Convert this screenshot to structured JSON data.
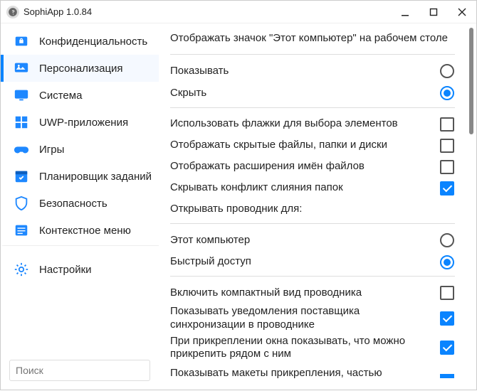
{
  "app": {
    "title": "SophiApp 1.0.84"
  },
  "search": {
    "placeholder": "Поиск"
  },
  "sidebar": {
    "items": [
      {
        "label": "Конфиденциальность",
        "icon": "privacy",
        "active": false
      },
      {
        "label": "Персонализация",
        "icon": "personalize",
        "active": true
      },
      {
        "label": "Система",
        "icon": "system",
        "active": false
      },
      {
        "label": "UWP-приложения",
        "icon": "uwp",
        "active": false
      },
      {
        "label": "Игры",
        "icon": "games",
        "active": false
      },
      {
        "label": "Планировщик заданий",
        "icon": "scheduler",
        "active": false
      },
      {
        "label": "Безопасность",
        "icon": "security",
        "active": false
      },
      {
        "label": "Контекстное меню",
        "icon": "context",
        "active": false
      },
      {
        "label": "Настройки",
        "icon": "settings",
        "active": false
      }
    ]
  },
  "content": {
    "section1_title": "Отображать значок \"Этот компьютер\" на рабочем столе",
    "radio1": [
      {
        "label": "Показывать",
        "selected": false
      },
      {
        "label": "Скрыть",
        "selected": true
      }
    ],
    "checks1": [
      {
        "label": "Использовать флажки для выбора элементов",
        "checked": false
      },
      {
        "label": "Отображать скрытые файлы, папки и диски",
        "checked": false
      },
      {
        "label": "Отображать расширения имён файлов",
        "checked": false
      },
      {
        "label": "Скрывать конфликт слияния папок",
        "checked": true
      }
    ],
    "section2_title": "Открывать проводник для:",
    "radio2": [
      {
        "label": "Этот компьютер",
        "selected": false
      },
      {
        "label": "Быстрый доступ",
        "selected": true
      }
    ],
    "checks2": [
      {
        "label": "Включить компактный вид проводника",
        "checked": false
      },
      {
        "label": "Показывать уведомления поставщика синхронизации в проводнике",
        "checked": true
      },
      {
        "label": "При прикреплении окна показывать, что можно прикрепить рядом с ним",
        "checked": true
      }
    ],
    "partial_row": {
      "label": "Показывать макеты прикрепления, частью"
    }
  },
  "colors": {
    "accent": "#0a84ff"
  }
}
